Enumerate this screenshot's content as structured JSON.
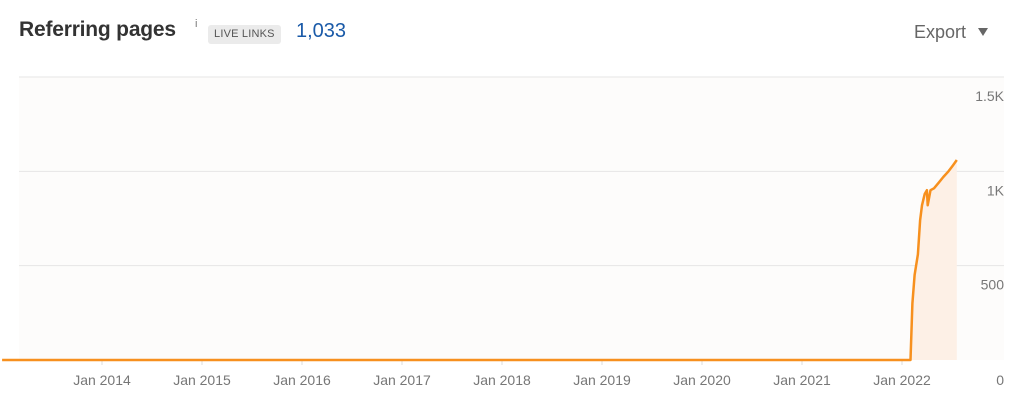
{
  "header": {
    "title": "Referring pages",
    "info_glyph": "i",
    "badge": "LIVE LINKS",
    "count": "1,033",
    "export_label": "Export"
  },
  "colors": {
    "line": "#f7901e",
    "area": "#fdf0e6",
    "plot_bg": "#fdfcfb",
    "grid": "#e6e6e6",
    "count_text": "#1a5aa8"
  },
  "chart_data": {
    "type": "area",
    "title": "Referring pages",
    "xlabel": "",
    "ylabel": "",
    "ylim": [
      0,
      1500
    ],
    "y_ticks": [
      {
        "value": 0,
        "label": "0"
      },
      {
        "value": 500,
        "label": "500"
      },
      {
        "value": 1000,
        "label": "1K"
      },
      {
        "value": 1500,
        "label": "1.5K"
      }
    ],
    "x_ticks": [
      "Jan 2014",
      "Jan 2015",
      "Jan 2016",
      "Jan 2017",
      "Jan 2018",
      "Jan 2019",
      "Jan 2020",
      "Jan 2021",
      "Jan 2022"
    ],
    "grid": true,
    "series": [
      {
        "values": [
          [
            "2013-01-01",
            0
          ],
          [
            "2022-02-01",
            0
          ],
          [
            "2022-02-08",
            300
          ],
          [
            "2022-02-16",
            450
          ],
          [
            "2022-02-28",
            560
          ],
          [
            "2022-03-08",
            740
          ],
          [
            "2022-03-15",
            820
          ],
          [
            "2022-03-25",
            880
          ],
          [
            "2022-04-02",
            900
          ],
          [
            "2022-04-05",
            820
          ],
          [
            "2022-04-15",
            900
          ],
          [
            "2022-04-28",
            910
          ],
          [
            "2022-05-15",
            940
          ],
          [
            "2022-06-01",
            970
          ],
          [
            "2022-06-20",
            1000
          ],
          [
            "2022-07-05",
            1030
          ],
          [
            "2022-07-20",
            1060
          ]
        ]
      }
    ]
  }
}
